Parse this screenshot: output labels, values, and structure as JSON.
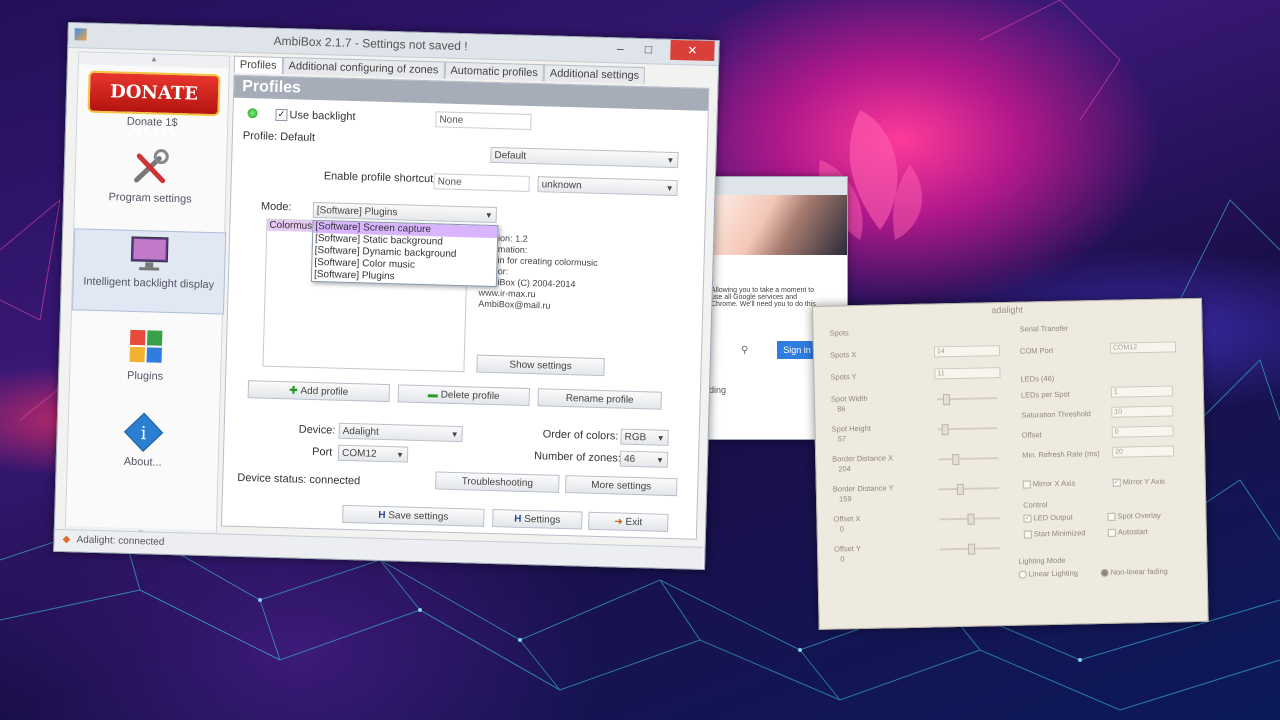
{
  "ambibox": {
    "title": "AmbiBox 2.1.7 - Settings not saved !",
    "sidebar": {
      "donate_label": "DONATE NOW",
      "donate_caption": "Donate 1$",
      "items": [
        {
          "label": "Program settings",
          "icon": "tools-icon"
        },
        {
          "label": "Intelligent backlight display",
          "icon": "monitor-icon"
        },
        {
          "label": "Plugins",
          "icon": "puzzle-icon"
        },
        {
          "label": "About...",
          "icon": "info-icon"
        }
      ]
    },
    "tabs": [
      "Profiles",
      "Additional configuring of zones",
      "Automatic profiles",
      "Additional settings"
    ],
    "panel_title": "Profiles",
    "use_backlight_label": "Use backlight",
    "backlight_field": "None",
    "profile_label": "Profile: Default",
    "profile_select": "Default",
    "shortcut_label": "Enable profile shortcut",
    "shortcut_field": "None",
    "shortcut_select": "unknown",
    "mode_label": "Mode:",
    "mode_value": "[Software] Plugins",
    "mode_options": [
      "[Software] Screen capture",
      "[Software] Static background",
      "[Software] Dynamic background",
      "[Software] Color music",
      "[Software] Plugins"
    ],
    "mode_selected_index": 0,
    "plugin_list_item": "Colormusic",
    "plugin_info": [
      "Version: 1.2",
      "Information:",
      "Plugin for creating colormusic",
      "Author:",
      "AmbiBox (C) 2004-2014",
      "www.ir-max.ru",
      "AmbiBox@mail.ru"
    ],
    "show_settings": "Show settings",
    "add_profile": "Add profile",
    "delete_profile": "Delete profile",
    "rename_profile": "Rename profile",
    "device_label": "Device:",
    "device_value": "Adalight",
    "port_label": "Port",
    "port_value": "COM12",
    "order_label": "Order of colors:",
    "order_value": "RGB",
    "zones_label": "Number of zones:",
    "zones_value": "46",
    "device_status": "Device status: connected",
    "troubleshooting": "Troubleshooting",
    "more_settings": "More settings",
    "save_settings": "Save settings",
    "settings": "Settings",
    "exit": "Exit",
    "status_text": "Adalight: connected"
  },
  "browser": {
    "text": "Allowing you to take a moment to use all Google services and Chrome. We'll need you to do this",
    "sign_in": "Sign in",
    "loading_fragment": "ding"
  },
  "adalight": {
    "title": "adalight",
    "spots_group": "Spots",
    "spots_x_label": "Spots X",
    "spots_x": "14",
    "spots_y_label": "Spots Y",
    "spots_y": "11",
    "spot_width_label": "Spot Width",
    "spot_width": "86",
    "spot_height_label": "Spot Height",
    "spot_height": "57",
    "border_x_label": "Border Distance X",
    "border_x": "204",
    "border_y_label": "Border Distance Y",
    "border_y": "159",
    "offset_x_label": "Offset X",
    "offset_x": "0",
    "offset_y_label": "Offset Y",
    "offset_y": "0",
    "serial_group": "Serial Transfer",
    "com_port_label": "COM Port",
    "com_port": "COM12",
    "leds_group": "LEDs (46)",
    "leds_per_spot_label": "LEDs per Spot",
    "leds_per_spot": "1",
    "saturation_label": "Saturation Threshold",
    "saturation": "10",
    "offset_label": "Offset",
    "offset": "0",
    "min_refresh_label": "Min. Refresh Rate (ms)",
    "min_refresh": "20",
    "mirror_x_label": "Mirror X Axis",
    "mirror_y_label": "Mirror Y Axis",
    "control_group": "Control",
    "led_output_label": "LED Output",
    "start_minimized_label": "Start Minimized",
    "spot_overlay_label": "Spot Overlay",
    "autostart_label": "Autostart",
    "lighting_group": "Lighting Mode",
    "linear_label": "Linear Lighting",
    "nonlinear_label": "Non-linear fading"
  }
}
